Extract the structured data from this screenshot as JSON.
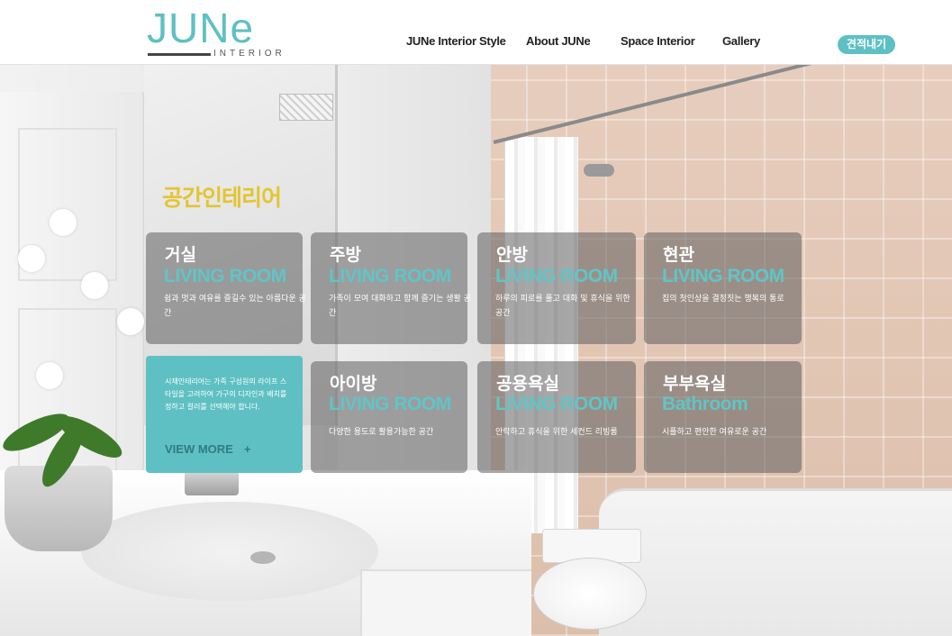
{
  "header": {
    "logo_main": "JUNe",
    "logo_sub": "INTERIOR",
    "nav": [
      "JUNe  Interior Style",
      "About JUNe",
      "Space Interior",
      "Gallery"
    ],
    "quote_button": "견적내기"
  },
  "section": {
    "title": "공간인테리어"
  },
  "cards": [
    {
      "title": "거실",
      "subtitle": "LIVING ROOM",
      "desc": "쉼과 멋과 여유를 즐길수 있는 아름다운 공간"
    },
    {
      "title": "주방",
      "subtitle": "LIVING ROOM",
      "desc": "가족이 모여 대화하고 함께 즐기는 생활 공간"
    },
    {
      "title": "안방",
      "subtitle": "LIVING ROOM",
      "desc": "하루의 피로를 풀고 대화 및 휴식을 위한 공간"
    },
    {
      "title": "현관",
      "subtitle": "LIVING ROOM",
      "desc": "집의 첫인상을 결정짓는 행복의 통로"
    },
    {
      "title": "아이방",
      "subtitle": "LIVING ROOM",
      "desc": "다양한 용도로 활용가능한 공간"
    },
    {
      "title": "공용욕실",
      "subtitle": "LIVING ROOM",
      "desc": "안락하고 휴식을 위한 세컨드 리빙룸"
    },
    {
      "title": "부부욕실",
      "subtitle": "Bathroom",
      "desc": "시플하고 편안한 여유로운 공간"
    }
  ],
  "promo": {
    "text": "시재인테리어는 가족 구성원의 라이프 스타일을 고려하여 가구의 디자인과 배치를 정하고 컬러를 선택해야 합니다.",
    "view_more": "VIEW MORE",
    "view_more_icon": "+"
  },
  "colors": {
    "accent": "#5ec0c3",
    "title_yellow": "#e3c52f",
    "card_overlay": "rgba(95,95,95,0.55)"
  }
}
